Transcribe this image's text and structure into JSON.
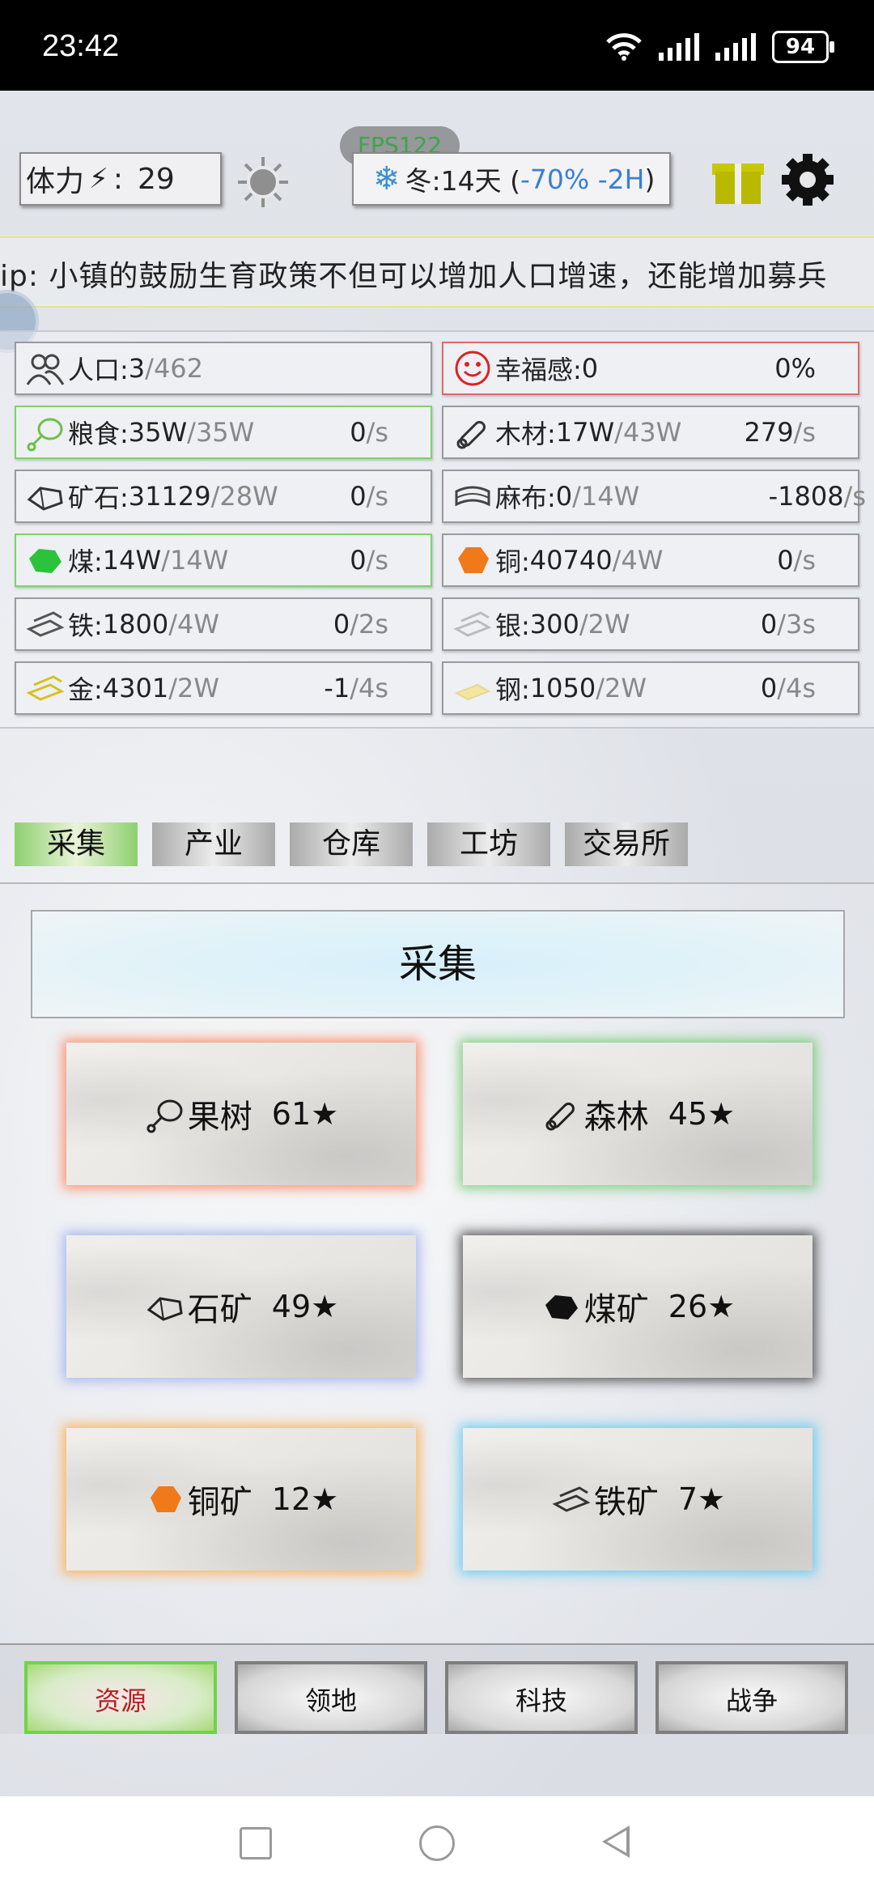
{
  "status": {
    "time": "23:42",
    "battery": "94"
  },
  "topbar": {
    "stamina_label": "体力",
    "stamina_sep": ":",
    "stamina_value": "29",
    "fps": "FPS122",
    "season": "冬:14天 (",
    "season_mod": "-70% -2H",
    "season_end": ")"
  },
  "tip": {
    "text": "ip:  小镇的鼓励生育政策不但可以增加人口增速，还能增加募兵"
  },
  "resources": [
    {
      "name": "人口:",
      "value": "3",
      "cap": "/462",
      "rate": "",
      "unit": "",
      "icon": "people-icon"
    },
    {
      "name": "幸福感:",
      "value": "0",
      "cap": "",
      "rate": "0%",
      "unit": "",
      "icon": "smile-icon"
    },
    {
      "name": "粮食:",
      "value": "35W",
      "cap": "/35W",
      "rate": "0",
      "unit": "/s",
      "icon": "meat-icon"
    },
    {
      "name": "木材:",
      "value": "17W",
      "cap": "/43W",
      "rate": "279",
      "unit": "/s",
      "icon": "wood-icon"
    },
    {
      "name": "矿石:",
      "value": "31129",
      "cap": "/28W",
      "rate": "0",
      "unit": "/s",
      "icon": "ore-icon"
    },
    {
      "name": "麻布:",
      "value": "0",
      "cap": "/14W",
      "rate": "-1808",
      "unit": "/s",
      "icon": "cloth-icon"
    },
    {
      "name": "煤:",
      "value": "14W",
      "cap": "/14W",
      "rate": "0",
      "unit": "/s",
      "icon": "coal-icon"
    },
    {
      "name": "铜:",
      "value": "40740",
      "cap": "/4W",
      "rate": "0",
      "unit": "/s",
      "icon": "copper-icon"
    },
    {
      "name": "铁:",
      "value": "1800",
      "cap": "/4W",
      "rate": "0",
      "unit": "/2s",
      "icon": "iron-icon"
    },
    {
      "name": "银:",
      "value": "300",
      "cap": "/2W",
      "rate": "0",
      "unit": "/3s",
      "icon": "silver-icon"
    },
    {
      "name": "金:",
      "value": "4301",
      "cap": "/2W",
      "rate": "-1",
      "unit": "/4s",
      "icon": "gold-icon"
    },
    {
      "name": "钢:",
      "value": "1050",
      "cap": "/2W",
      "rate": "0",
      "unit": "/4s",
      "icon": "steel-icon"
    }
  ],
  "tabs": [
    "采集",
    "产业",
    "仓库",
    "工坊",
    "交易所"
  ],
  "panel": {
    "title": "采集"
  },
  "cards": [
    {
      "name": "果树",
      "stars": "61★",
      "icon": "meat-icon"
    },
    {
      "name": "森林",
      "stars": "45★",
      "icon": "wood-icon"
    },
    {
      "name": "石矿",
      "stars": "49★",
      "icon": "ore-icon"
    },
    {
      "name": "煤矿",
      "stars": "26★",
      "icon": "coal-icon"
    },
    {
      "name": "铜矿",
      "stars": "12★",
      "icon": "copper-icon"
    },
    {
      "name": "铁矿",
      "stars": "7★",
      "icon": "iron-icon"
    }
  ],
  "bottom_nav": [
    "资源",
    "领地",
    "科技",
    "战争"
  ],
  "colors": {
    "accent_green": "#7ed36b",
    "alert_red": "#e06a6a",
    "season_blue": "#3a7fd0"
  }
}
